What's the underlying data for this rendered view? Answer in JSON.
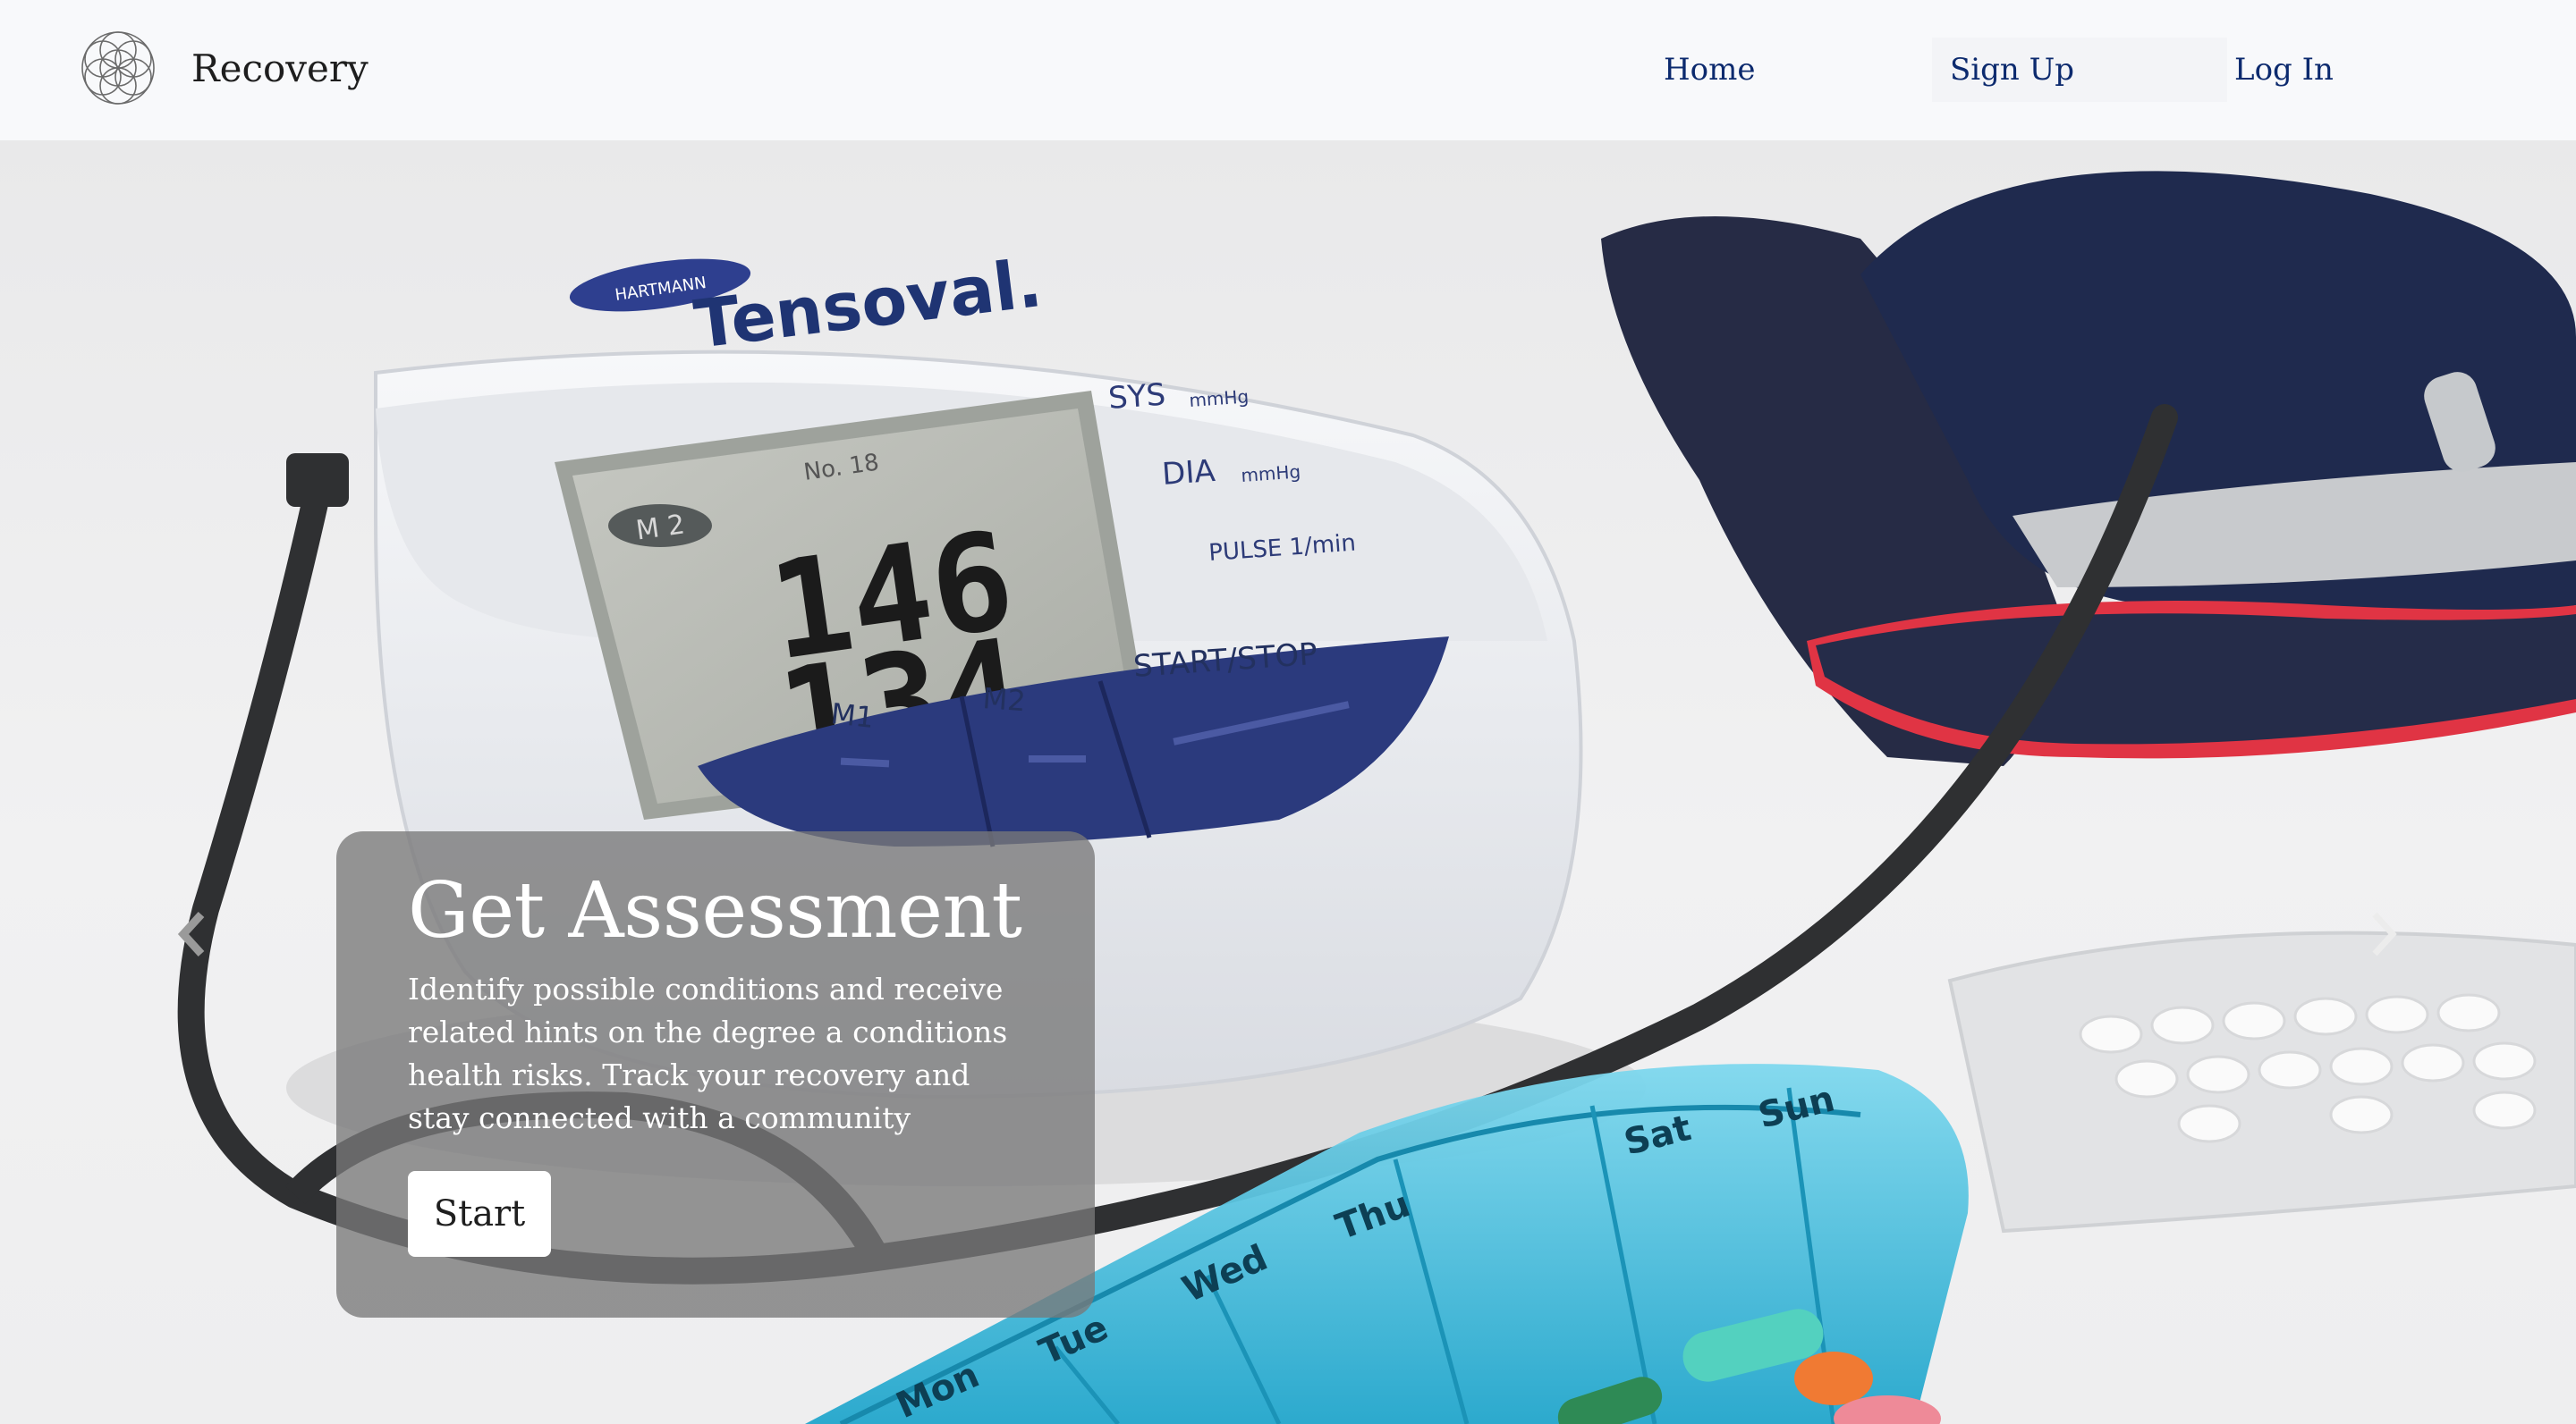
{
  "brand": {
    "name": "Recovery"
  },
  "nav": {
    "home": "Home",
    "signup": "Sign Up",
    "login": "Log In"
  },
  "hero": {
    "title": "Get Assessment",
    "description": "Identify possible conditions and receive related hints on the degree a conditions health risks. Track your recovery and stay connected with a community",
    "start_label": "Start",
    "image_text": {
      "brand_badge": "HARTMANN",
      "device_name": "Tensoval.",
      "sys_label": "SYS",
      "dia_label": "DIA",
      "unit": "mmHg",
      "pulse_label": "PULSE 1/min",
      "memory_badge": "M 2",
      "memory_index": "No. 18",
      "systolic_reading": "146",
      "diastolic_reading": "134",
      "button_m1": "M1",
      "button_m2": "M2",
      "button_start": "START/STOP",
      "pill_days": [
        "Mon",
        "Tue",
        "Wed",
        "Thu",
        "Sat",
        "Sun"
      ]
    }
  },
  "colors": {
    "nav_link": "#0c2a6e",
    "caption_bg": "rgba(120,120,120,0.78)",
    "device_blue": "#2b3a7d",
    "cuff_navy": "#262b45",
    "cuff_red": "#e03444",
    "pill_box": "#36b8d8"
  },
  "icons": {
    "logo": "flower-of-life-icon",
    "prev": "chevron-left-icon",
    "next": "chevron-right-icon"
  }
}
